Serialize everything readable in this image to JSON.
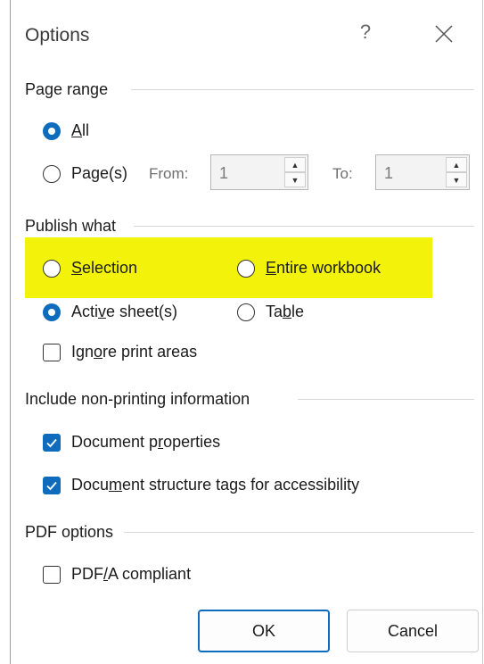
{
  "dialog": {
    "title": "Options",
    "help_glyph": "?"
  },
  "page_range": {
    "label": "Page range",
    "all": {
      "label": "All",
      "mnemonic": "A",
      "rest": "ll",
      "checked": true
    },
    "pages": {
      "label": "Page(s)",
      "pre": "Pa",
      "mnemonic": "g",
      "post": "e(s)",
      "checked": false
    },
    "from_label": "From:",
    "from_value": "1",
    "to_label": "To:",
    "to_value": "1"
  },
  "publish_what": {
    "label": "Publish what",
    "selection": {
      "label": "Selection",
      "mnemonic": "S",
      "rest": "election",
      "checked": false
    },
    "entire_workbook": {
      "label": "Entire workbook",
      "mnemonic": "E",
      "rest": "ntire workbook",
      "checked": false
    },
    "active_sheets": {
      "label": "Active sheet(s)",
      "pre": "Acti",
      "mnemonic": "v",
      "post": "e sheet(s)",
      "checked": true
    },
    "table": {
      "label": "Table",
      "pre": "Ta",
      "mnemonic": "b",
      "post": "le",
      "checked": false
    },
    "ignore_print_areas": {
      "label": "Ignore print areas",
      "pre": "Ign",
      "mnemonic": "o",
      "post": "re print areas",
      "checked": false
    },
    "highlight_color": "#f2f20a"
  },
  "non_printing": {
    "label": "Include non-printing information",
    "document_properties": {
      "label": "Document properties",
      "pre": "Document p",
      "mnemonic": "r",
      "post": "operties",
      "checked": true
    },
    "structure_tags": {
      "label": "Document structure tags for accessibility",
      "pre": "Docu",
      "mnemonic": "m",
      "post": "ent structure tags for accessibility",
      "checked": true
    }
  },
  "pdf_options": {
    "label": "PDF options",
    "pdfa": {
      "label": "PDF/A compliant",
      "pre": "PDF",
      "mnemonic": "/",
      "post": "A compliant",
      "checked": false
    }
  },
  "buttons": {
    "ok": "OK",
    "cancel": "Cancel"
  },
  "colors": {
    "accent": "#0f6cbd"
  }
}
